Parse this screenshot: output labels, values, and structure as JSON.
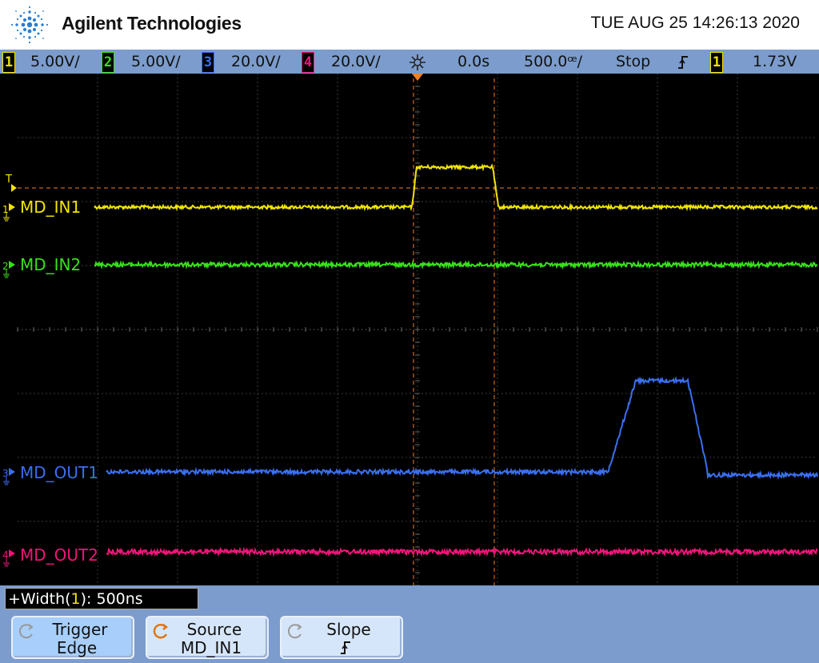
{
  "header": {
    "brand": "Agilent Technologies",
    "datetime": "TUE AUG 25 14:26:13 2020"
  },
  "status_bar": {
    "channels": [
      {
        "number": "1",
        "scale": "5.00V/",
        "color": "#f2e400"
      },
      {
        "number": "2",
        "scale": "5.00V/",
        "color": "#39e01a"
      },
      {
        "number": "3",
        "scale": "20.0V/",
        "color": "#3a6ff0"
      },
      {
        "number": "4",
        "scale": "20.0V/",
        "color": "#f0157a"
      }
    ],
    "delay_icon": "sun-asterisk-icon",
    "delay": "0.0s",
    "timebase": "500.0ꟹ/",
    "run_state": "Stop",
    "trigger_slope_icon": "rising-edge-icon",
    "trigger_channel": "1",
    "trigger_level": "1.73V"
  },
  "traces": [
    {
      "name": "MD_IN1",
      "channel": "1",
      "color": "#f2e400"
    },
    {
      "name": "MD_IN2",
      "channel": "2",
      "color": "#39e01a"
    },
    {
      "name": "MD_OUT1",
      "channel": "3",
      "color": "#3a6ff0"
    },
    {
      "name": "MD_OUT2",
      "channel": "4",
      "color": "#f0157a"
    }
  ],
  "trigger_marker": "T",
  "measurement": {
    "prefix": "+Width(",
    "channel": "1",
    "suffix": "): 500ns"
  },
  "softkeys": [
    {
      "line1": "Trigger",
      "line2": "Edge",
      "icon": "rotate-arrow-icon"
    },
    {
      "line1": "Source",
      "line2": "MD_IN1",
      "icon": "rotate-arrow-icon"
    },
    {
      "line1": "Slope",
      "line2": "ꜰ",
      "icon": "rotate-arrow-icon"
    }
  ]
}
